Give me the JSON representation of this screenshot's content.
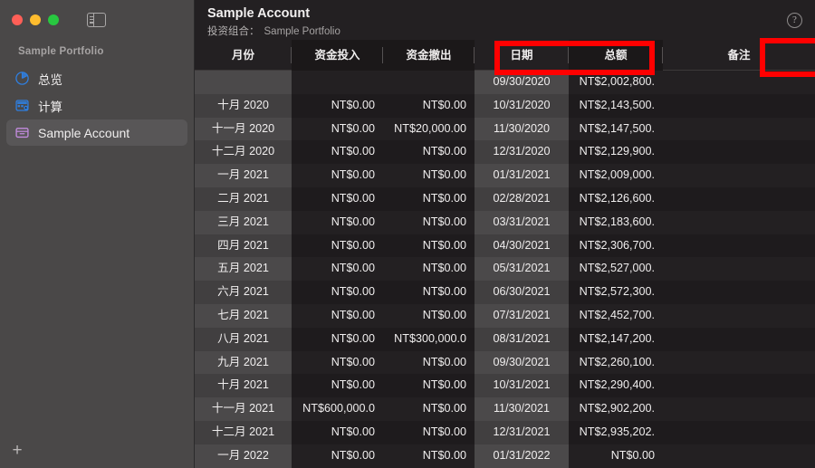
{
  "window": {
    "traffic_lights": [
      "close",
      "minimize",
      "zoom"
    ],
    "sidebar_toggle_name": "sidebar-toggle-icon"
  },
  "sidebar": {
    "section_title": "Sample Portfolio",
    "items": [
      {
        "label": "总览",
        "icon": "pie-chart-icon",
        "selected": false
      },
      {
        "label": "计算",
        "icon": "calculator-icon",
        "selected": false
      },
      {
        "label": "Sample Account",
        "icon": "archive-box-icon",
        "selected": true
      }
    ],
    "add_button_label": "+"
  },
  "header": {
    "title": "Sample Account",
    "portfolio_label": "投资组合：",
    "portfolio_name": "Sample Portfolio",
    "help_label": "?"
  },
  "table": {
    "columns": [
      {
        "key": "month",
        "label": "月份"
      },
      {
        "key": "in",
        "label": "资金投入"
      },
      {
        "key": "out",
        "label": "资金撤出"
      },
      {
        "key": "date",
        "label": "日期"
      },
      {
        "key": "total",
        "label": "总额"
      },
      {
        "key": "notes",
        "label": "备注"
      }
    ],
    "rows": [
      {
        "month": "",
        "in": "",
        "out": "",
        "date": "09/30/2020",
        "total": "NT$2,002,800.",
        "notes": ""
      },
      {
        "month": "十月 2020",
        "in": "NT$0.00",
        "out": "NT$0.00",
        "date": "10/31/2020",
        "total": "NT$2,143,500.",
        "notes": ""
      },
      {
        "month": "十一月 2020",
        "in": "NT$0.00",
        "out": "NT$20,000.00",
        "date": "11/30/2020",
        "total": "NT$2,147,500.",
        "notes": ""
      },
      {
        "month": "十二月 2020",
        "in": "NT$0.00",
        "out": "NT$0.00",
        "date": "12/31/2020",
        "total": "NT$2,129,900.",
        "notes": ""
      },
      {
        "month": "一月 2021",
        "in": "NT$0.00",
        "out": "NT$0.00",
        "date": "01/31/2021",
        "total": "NT$2,009,000.",
        "notes": ""
      },
      {
        "month": "二月 2021",
        "in": "NT$0.00",
        "out": "NT$0.00",
        "date": "02/28/2021",
        "total": "NT$2,126,600.",
        "notes": ""
      },
      {
        "month": "三月 2021",
        "in": "NT$0.00",
        "out": "NT$0.00",
        "date": "03/31/2021",
        "total": "NT$2,183,600.",
        "notes": ""
      },
      {
        "month": "四月 2021",
        "in": "NT$0.00",
        "out": "NT$0.00",
        "date": "04/30/2021",
        "total": "NT$2,306,700.",
        "notes": ""
      },
      {
        "month": "五月 2021",
        "in": "NT$0.00",
        "out": "NT$0.00",
        "date": "05/31/2021",
        "total": "NT$2,527,000.",
        "notes": ""
      },
      {
        "month": "六月 2021",
        "in": "NT$0.00",
        "out": "NT$0.00",
        "date": "06/30/2021",
        "total": "NT$2,572,300.",
        "notes": ""
      },
      {
        "month": "七月 2021",
        "in": "NT$0.00",
        "out": "NT$0.00",
        "date": "07/31/2021",
        "total": "NT$2,452,700.",
        "notes": ""
      },
      {
        "month": "八月 2021",
        "in": "NT$0.00",
        "out": "NT$300,000.0",
        "date": "08/31/2021",
        "total": "NT$2,147,200.",
        "notes": ""
      },
      {
        "month": "九月 2021",
        "in": "NT$0.00",
        "out": "NT$0.00",
        "date": "09/30/2021",
        "total": "NT$2,260,100.",
        "notes": ""
      },
      {
        "month": "十月 2021",
        "in": "NT$0.00",
        "out": "NT$0.00",
        "date": "10/31/2021",
        "total": "NT$2,290,400.",
        "notes": ""
      },
      {
        "month": "十一月 2021",
        "in": "NT$600,000.0",
        "out": "NT$0.00",
        "date": "11/30/2021",
        "total": "NT$2,902,200.",
        "notes": ""
      },
      {
        "month": "十二月 2021",
        "in": "NT$0.00",
        "out": "NT$0.00",
        "date": "12/31/2021",
        "total": "NT$2,935,202.",
        "notes": ""
      },
      {
        "month": "一月 2022",
        "in": "NT$0.00",
        "out": "NT$0.00",
        "date": "01/31/2022",
        "total": "NT$0.00",
        "notes": ""
      }
    ]
  },
  "annotations": [
    {
      "name": "highlight-box-contributions-withdrawals",
      "color": "#ff0000"
    },
    {
      "name": "highlight-box-total",
      "color": "#ff0000"
    }
  ],
  "colors": {
    "sidebar_bg": "#4a4848",
    "main_bg": "#232022",
    "row_odd": "#4b494a",
    "row_even": "#413f40",
    "accent_purple": "#c48ce0",
    "accent_blue": "#2f7fe0",
    "annotation_red": "#ff0000"
  }
}
